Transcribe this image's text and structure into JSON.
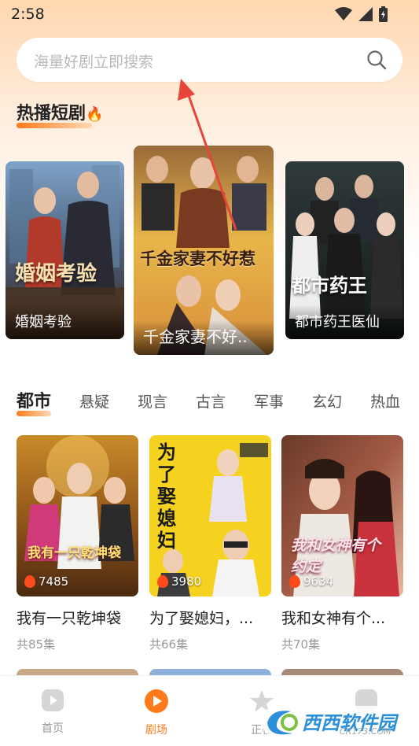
{
  "status_bar": {
    "time": "2:58"
  },
  "search": {
    "placeholder": "海量好剧立即搜索"
  },
  "hot_section": {
    "title": "热播短剧",
    "emoji": "🔥",
    "cards": [
      {
        "caption": "婚姻考验",
        "poster_text": "婚姻考验"
      },
      {
        "caption": "千金家妻不好..",
        "poster_text": "千金家妻不好惹"
      },
      {
        "caption": "都市药王医仙",
        "poster_text": "都市药王"
      }
    ]
  },
  "categories": [
    "都市",
    "悬疑",
    "现言",
    "古言",
    "军事",
    "玄幻",
    "热血"
  ],
  "grid": [
    {
      "title": "我有一只乾坤袋",
      "episodes": "共85集",
      "views": "7485",
      "poster_text": "我有一只乾坤袋"
    },
    {
      "title": "为了娶媳妇，...",
      "episodes": "共66集",
      "views": "3980",
      "poster_text": "为了娶媳妇"
    },
    {
      "title": "我和女神有个...",
      "episodes": "共70集",
      "views": "9634",
      "poster_text": "我和女神有个约定"
    }
  ],
  "bottom_nav": [
    {
      "label": "首页",
      "icon": "play-icon"
    },
    {
      "label": "剧场",
      "icon": "theater-icon"
    },
    {
      "label": "正在",
      "icon": "star-icon"
    },
    {
      "label": "",
      "icon": "profile-icon"
    }
  ],
  "watermark": {
    "text": "西西软件园",
    "sub": "CR173.COM"
  },
  "colors": {
    "accent": "#ff7a1a",
    "header_bg": "#ffd7b0"
  }
}
